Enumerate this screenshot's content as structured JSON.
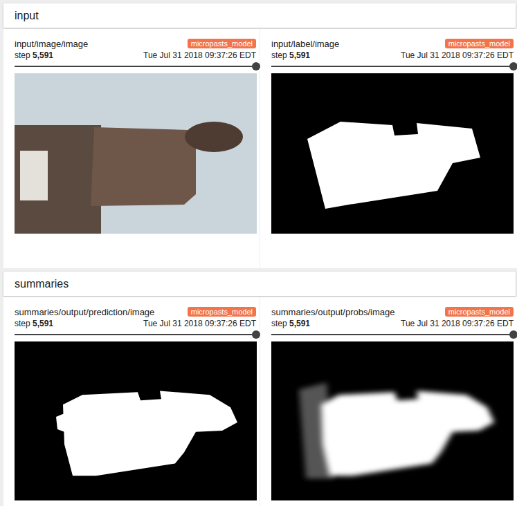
{
  "sections": [
    {
      "title": "input",
      "cards": [
        {
          "tag": "input/image/image",
          "run": "micropasts_model",
          "step_label": "step",
          "step": "5,591",
          "time": "Tue Jul 31 2018 09:37:26 EDT",
          "level": 1,
          "kind": "photo"
        },
        {
          "tag": "input/label/image",
          "run": "micropasts_model",
          "step_label": "step",
          "step": "5,591",
          "time": "Tue Jul 31 2018 09:37:26 EDT",
          "level": 1,
          "kind": "mask"
        }
      ]
    },
    {
      "title": "summaries",
      "cards": [
        {
          "tag": "summaries/output/prediction/image",
          "run": "micropasts_model",
          "step_label": "step",
          "step": "5,591",
          "time": "Tue Jul 31 2018 09:37:26 EDT",
          "level": 1,
          "kind": "prediction"
        },
        {
          "tag": "summaries/output/probs/image",
          "run": "micropasts_model",
          "step_label": "step",
          "step": "5,591",
          "time": "Tue Jul 31 2018 09:37:26 EDT",
          "level": 1,
          "kind": "probs"
        }
      ]
    }
  ]
}
